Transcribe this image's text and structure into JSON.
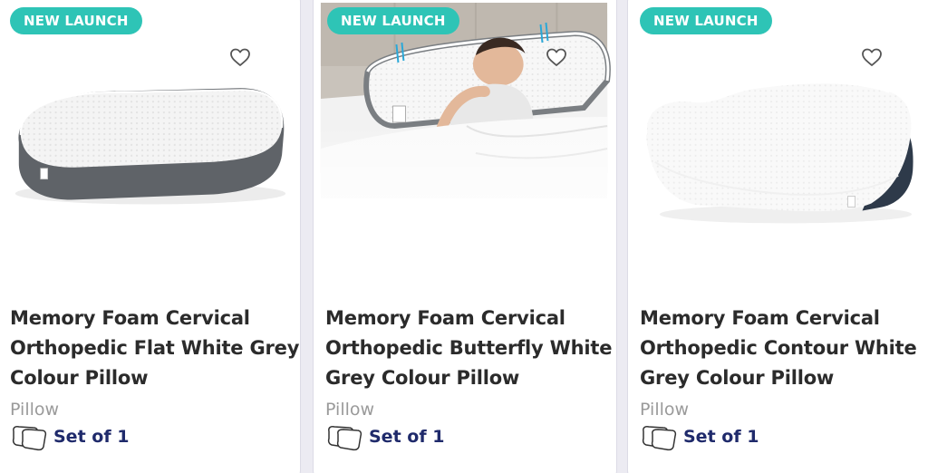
{
  "products": [
    {
      "badge": "NEW LAUNCH",
      "title": "Memory Foam Cervical Orthopedic Flat White Grey Colour Pillow",
      "category": "Pillow",
      "pack": "Set of 1",
      "wishlist_icon": "heart-outline-icon",
      "pack_icon": "pillows-icon"
    },
    {
      "badge": "NEW LAUNCH",
      "title": "Memory Foam Cervical Orthopedic Butterfly White Grey Colour Pillow",
      "category": "Pillow",
      "pack": "Set of 1",
      "wishlist_icon": "heart-outline-icon",
      "pack_icon": "pillows-icon"
    },
    {
      "badge": "NEW LAUNCH",
      "title": "Memory Foam Cervical Orthopedic Contour White Grey Colour Pillow",
      "category": "Pillow",
      "pack": "Set of 1",
      "wishlist_icon": "heart-outline-icon",
      "pack_icon": "pillows-icon"
    }
  ],
  "colors": {
    "badge": "#2ec4b6",
    "title": "#2b2b2b",
    "category": "#9a9a9a",
    "pack": "#1f2a6b",
    "pillow_border": "#555a5e"
  }
}
